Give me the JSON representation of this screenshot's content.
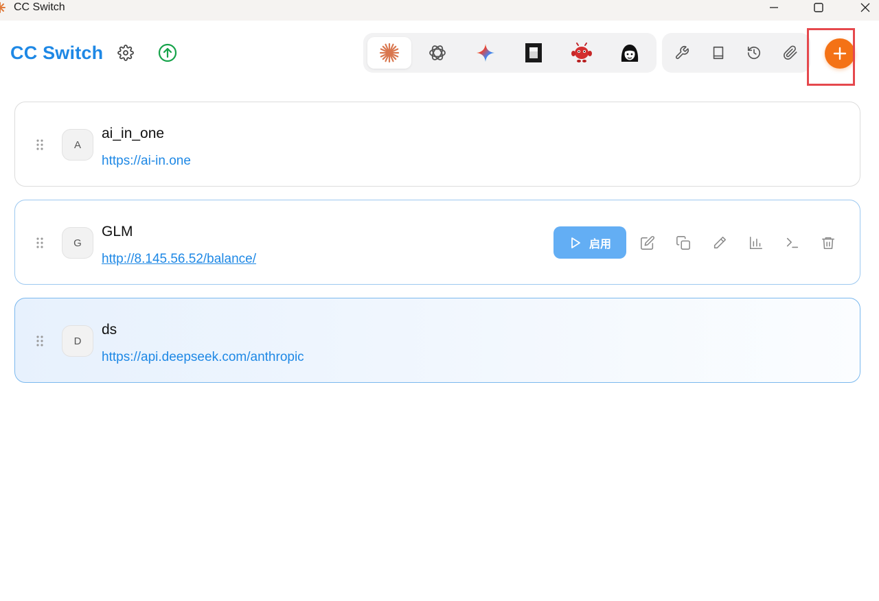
{
  "window": {
    "title": "CC Switch"
  },
  "header": {
    "brand": "CC Switch"
  },
  "app_tabs": [
    {
      "name": "claude",
      "active": true
    },
    {
      "name": "openai"
    },
    {
      "name": "gemini"
    },
    {
      "name": "dark-square"
    },
    {
      "name": "red-robot"
    },
    {
      "name": "face-avatar"
    }
  ],
  "tools": [
    "wrench-icon",
    "book-icon",
    "history-icon",
    "paperclip-icon"
  ],
  "colors": {
    "brand": "#1e88e5",
    "add_button": "#f47216",
    "enable_button": "#63aef4",
    "highlight": "#e5484d"
  },
  "providers": [
    {
      "initial": "A",
      "name": "ai_in_one",
      "url": "https://ai-in.one"
    },
    {
      "initial": "G",
      "name": "GLM",
      "url": "http://8.145.56.52/balance/",
      "enable_label": "启用"
    },
    {
      "initial": "D",
      "name": "ds",
      "url": "https://api.deepseek.com/anthropic"
    }
  ]
}
